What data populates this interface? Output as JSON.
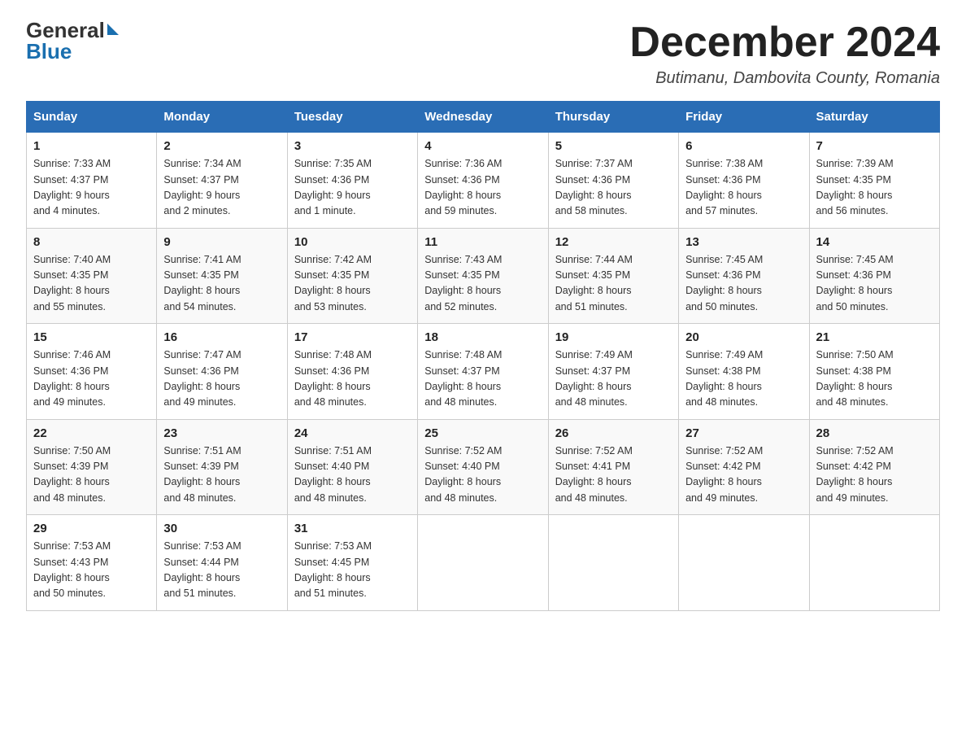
{
  "logo": {
    "general": "General",
    "blue": "Blue"
  },
  "title": "December 2024",
  "location": "Butimanu, Dambovita County, Romania",
  "days_of_week": [
    "Sunday",
    "Monday",
    "Tuesday",
    "Wednesday",
    "Thursday",
    "Friday",
    "Saturday"
  ],
  "weeks": [
    [
      {
        "day": "1",
        "sunrise": "7:33 AM",
        "sunset": "4:37 PM",
        "daylight": "9 hours and 4 minutes."
      },
      {
        "day": "2",
        "sunrise": "7:34 AM",
        "sunset": "4:37 PM",
        "daylight": "9 hours and 2 minutes."
      },
      {
        "day": "3",
        "sunrise": "7:35 AM",
        "sunset": "4:36 PM",
        "daylight": "9 hours and 1 minute."
      },
      {
        "day": "4",
        "sunrise": "7:36 AM",
        "sunset": "4:36 PM",
        "daylight": "8 hours and 59 minutes."
      },
      {
        "day": "5",
        "sunrise": "7:37 AM",
        "sunset": "4:36 PM",
        "daylight": "8 hours and 58 minutes."
      },
      {
        "day": "6",
        "sunrise": "7:38 AM",
        "sunset": "4:36 PM",
        "daylight": "8 hours and 57 minutes."
      },
      {
        "day": "7",
        "sunrise": "7:39 AM",
        "sunset": "4:35 PM",
        "daylight": "8 hours and 56 minutes."
      }
    ],
    [
      {
        "day": "8",
        "sunrise": "7:40 AM",
        "sunset": "4:35 PM",
        "daylight": "8 hours and 55 minutes."
      },
      {
        "day": "9",
        "sunrise": "7:41 AM",
        "sunset": "4:35 PM",
        "daylight": "8 hours and 54 minutes."
      },
      {
        "day": "10",
        "sunrise": "7:42 AM",
        "sunset": "4:35 PM",
        "daylight": "8 hours and 53 minutes."
      },
      {
        "day": "11",
        "sunrise": "7:43 AM",
        "sunset": "4:35 PM",
        "daylight": "8 hours and 52 minutes."
      },
      {
        "day": "12",
        "sunrise": "7:44 AM",
        "sunset": "4:35 PM",
        "daylight": "8 hours and 51 minutes."
      },
      {
        "day": "13",
        "sunrise": "7:45 AM",
        "sunset": "4:36 PM",
        "daylight": "8 hours and 50 minutes."
      },
      {
        "day": "14",
        "sunrise": "7:45 AM",
        "sunset": "4:36 PM",
        "daylight": "8 hours and 50 minutes."
      }
    ],
    [
      {
        "day": "15",
        "sunrise": "7:46 AM",
        "sunset": "4:36 PM",
        "daylight": "8 hours and 49 minutes."
      },
      {
        "day": "16",
        "sunrise": "7:47 AM",
        "sunset": "4:36 PM",
        "daylight": "8 hours and 49 minutes."
      },
      {
        "day": "17",
        "sunrise": "7:48 AM",
        "sunset": "4:36 PM",
        "daylight": "8 hours and 48 minutes."
      },
      {
        "day": "18",
        "sunrise": "7:48 AM",
        "sunset": "4:37 PM",
        "daylight": "8 hours and 48 minutes."
      },
      {
        "day": "19",
        "sunrise": "7:49 AM",
        "sunset": "4:37 PM",
        "daylight": "8 hours and 48 minutes."
      },
      {
        "day": "20",
        "sunrise": "7:49 AM",
        "sunset": "4:38 PM",
        "daylight": "8 hours and 48 minutes."
      },
      {
        "day": "21",
        "sunrise": "7:50 AM",
        "sunset": "4:38 PM",
        "daylight": "8 hours and 48 minutes."
      }
    ],
    [
      {
        "day": "22",
        "sunrise": "7:50 AM",
        "sunset": "4:39 PM",
        "daylight": "8 hours and 48 minutes."
      },
      {
        "day": "23",
        "sunrise": "7:51 AM",
        "sunset": "4:39 PM",
        "daylight": "8 hours and 48 minutes."
      },
      {
        "day": "24",
        "sunrise": "7:51 AM",
        "sunset": "4:40 PM",
        "daylight": "8 hours and 48 minutes."
      },
      {
        "day": "25",
        "sunrise": "7:52 AM",
        "sunset": "4:40 PM",
        "daylight": "8 hours and 48 minutes."
      },
      {
        "day": "26",
        "sunrise": "7:52 AM",
        "sunset": "4:41 PM",
        "daylight": "8 hours and 48 minutes."
      },
      {
        "day": "27",
        "sunrise": "7:52 AM",
        "sunset": "4:42 PM",
        "daylight": "8 hours and 49 minutes."
      },
      {
        "day": "28",
        "sunrise": "7:52 AM",
        "sunset": "4:42 PM",
        "daylight": "8 hours and 49 minutes."
      }
    ],
    [
      {
        "day": "29",
        "sunrise": "7:53 AM",
        "sunset": "4:43 PM",
        "daylight": "8 hours and 50 minutes."
      },
      {
        "day": "30",
        "sunrise": "7:53 AM",
        "sunset": "4:44 PM",
        "daylight": "8 hours and 51 minutes."
      },
      {
        "day": "31",
        "sunrise": "7:53 AM",
        "sunset": "4:45 PM",
        "daylight": "8 hours and 51 minutes."
      },
      null,
      null,
      null,
      null
    ]
  ],
  "labels": {
    "sunrise": "Sunrise:",
    "sunset": "Sunset:",
    "daylight": "Daylight:"
  }
}
